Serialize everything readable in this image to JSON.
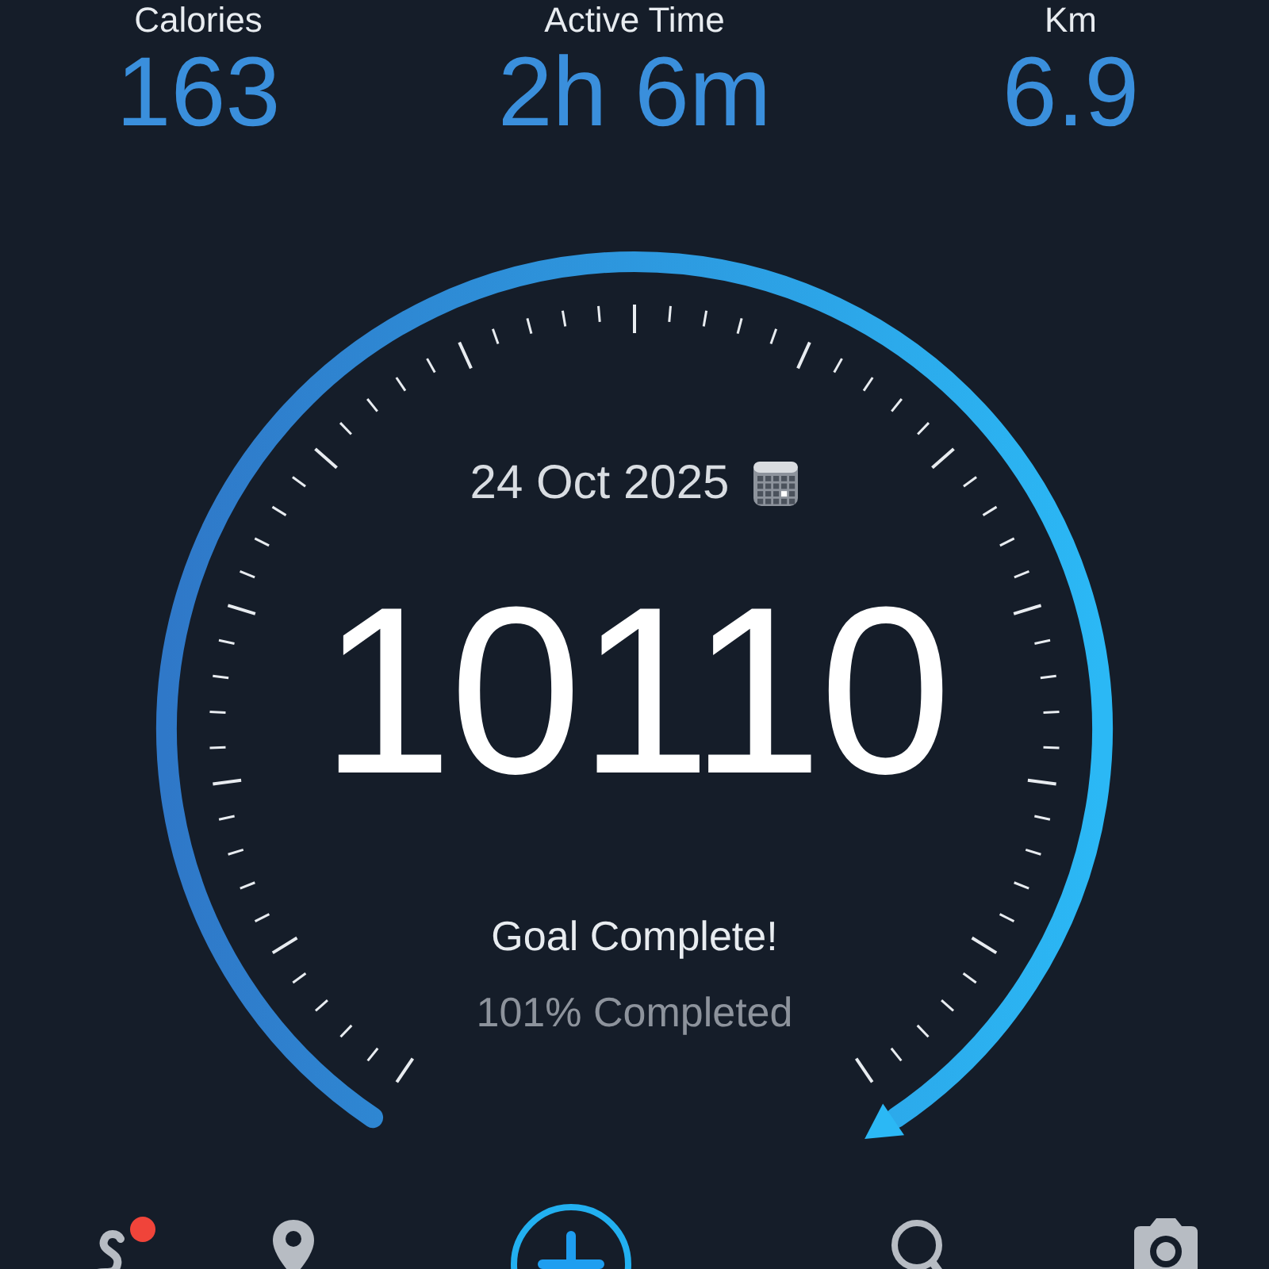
{
  "stats": [
    {
      "label": "Calories",
      "value": "163"
    },
    {
      "label": "Active Time",
      "value": "2h 6m"
    },
    {
      "label": "Km",
      "value": "6.9"
    }
  ],
  "dial": {
    "date": "24 Oct 2025",
    "steps": "10110",
    "message": "Goal Complete!",
    "progress_text": "101% Completed"
  },
  "nav": [
    {
      "kind": "route",
      "badge": true
    },
    {
      "kind": "pin",
      "badge": false
    },
    {
      "kind": "add",
      "badge": false
    },
    {
      "kind": "search",
      "badge": false
    },
    {
      "kind": "camera",
      "badge": false
    }
  ]
}
